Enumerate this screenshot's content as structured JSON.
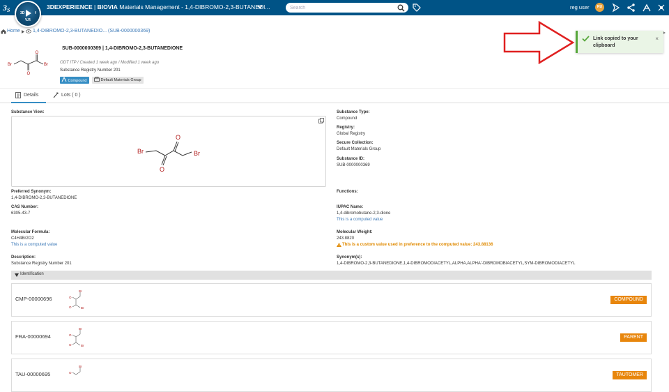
{
  "topbar": {
    "brand_prefix": "3DEXPERIENCE",
    "brand_app": "BIOVIA",
    "app_name": "Materials Management - 1,4-DIBROMO-2,3-BUTANEDI...",
    "compass_label": "V.R",
    "search_placeholder": "Search",
    "user_name": "reg user",
    "avatar_initials": "RU"
  },
  "breadcrumb": {
    "home": "Home",
    "current": "1,4-DIBROMO-2,3-BUTANEDIO... (SUB-0000000369)"
  },
  "header": {
    "title": "SUB-0000000369 | 1,4-DIBROMO-2,3-BUTANEDIONE",
    "meta": "ODT ITP / Created 1 week ago / Modified 1 week ago",
    "description": "Substance Registry Number 201",
    "badge_compound": "Compound",
    "badge_group": "Default Materials Group"
  },
  "toast": {
    "message": "Link copied to your clipboard",
    "close": "×"
  },
  "tabs": [
    {
      "label": "Details"
    },
    {
      "label": "Lots ( 0 )"
    }
  ],
  "fields": {
    "substance_view_label": "Substance View:",
    "substance_type_label": "Substance Type:",
    "substance_type_value": "Compound",
    "registry_label": "Registry:",
    "registry_value": "Global Registry",
    "secure_collection_label": "Secure Collection:",
    "secure_collection_value": "Default Materials Group",
    "substance_id_label": "Substance ID:",
    "substance_id_value": "SUB-0000000369",
    "preferred_synonym_label": "Preferred Synonym:",
    "preferred_synonym_value": "1,4-DIBROMO-2,3-BUTANEDIONE",
    "functions_label": "Functions:",
    "cas_label": "CAS Number:",
    "cas_value": "6305-43-7",
    "iupac_label": "IUPAC Name:",
    "iupac_value": "1,4-dibromobutane-2,3-dione",
    "iupac_note": "This is a computed value",
    "formula_label": "Molecular Formula:",
    "formula_value": "C4H4Br2O2",
    "formula_note": "This is a computed value",
    "weight_label": "Molecular Weight:",
    "weight_value": "243.8820",
    "weight_warning": "This is a custom value used in preference to the computed value: 243.88136",
    "description_label": "Description:",
    "description_value": "Substance Registry Number 201",
    "synonyms_label": "Synonym(s):",
    "synonyms_value": "1,4-DIBROMO-2,3-BUTANEDIONE,1,4-DIBROMODIACETYL,ALPHA,ALPHA'-DIBROMOBIACETYL,SYM-DIBROMODIACETYL"
  },
  "molecule_labels": {
    "br": "Br",
    "o": "O"
  },
  "identification": {
    "title": "Identification",
    "items": [
      {
        "id": "CMP-00000696",
        "tag": "COMPOUND"
      },
      {
        "id": "FRA-00000694",
        "tag": "PARENT"
      },
      {
        "id": "TAU-00000695",
        "tag": "TAUTOMER"
      }
    ]
  },
  "colors": {
    "topbar": "#005386",
    "accent": "#368ec4",
    "tag_orange": "#e8860c",
    "toast_green": "#57a73b",
    "annotation_red": "#e02020"
  }
}
